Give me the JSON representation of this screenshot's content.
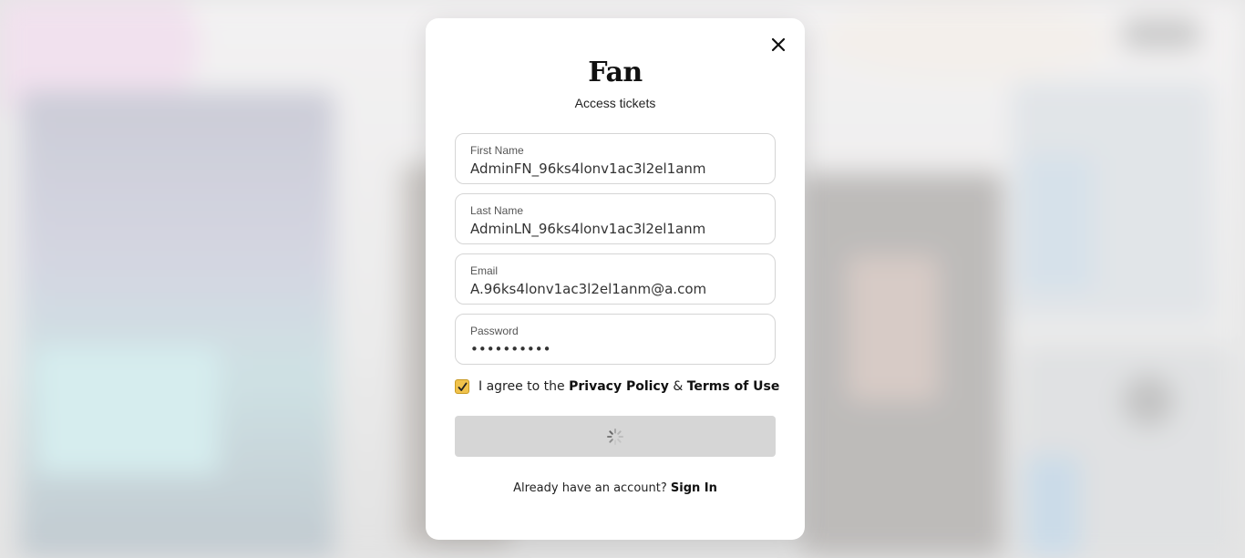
{
  "modal": {
    "title": "Fan",
    "subtitle": "Access tickets",
    "close_icon": "close-icon"
  },
  "form": {
    "first_name": {
      "label": "First Name",
      "value": "AdminFN_96ks4lonv1ac3l2el1anm"
    },
    "last_name": {
      "label": "Last Name",
      "value": "AdminLN_96ks4lonv1ac3l2el1anm"
    },
    "email": {
      "label": "Email",
      "value": "A.96ks4lonv1ac3l2el1anm@a.com"
    },
    "password": {
      "label": "Password",
      "value": "••••••••••"
    },
    "agree": {
      "checked": true,
      "prefix": "I agree to the",
      "privacy_link": "Privacy Policy",
      "joiner": "&",
      "terms_link": "Terms of Use"
    },
    "submit": {
      "state": "loading",
      "icon": "spinner-icon"
    }
  },
  "footer": {
    "prompt": "Already have an account?",
    "signin_link": "Sign In"
  },
  "colors": {
    "checkbox": "#f0c24b",
    "submit_disabled": "#d6d6d6"
  }
}
